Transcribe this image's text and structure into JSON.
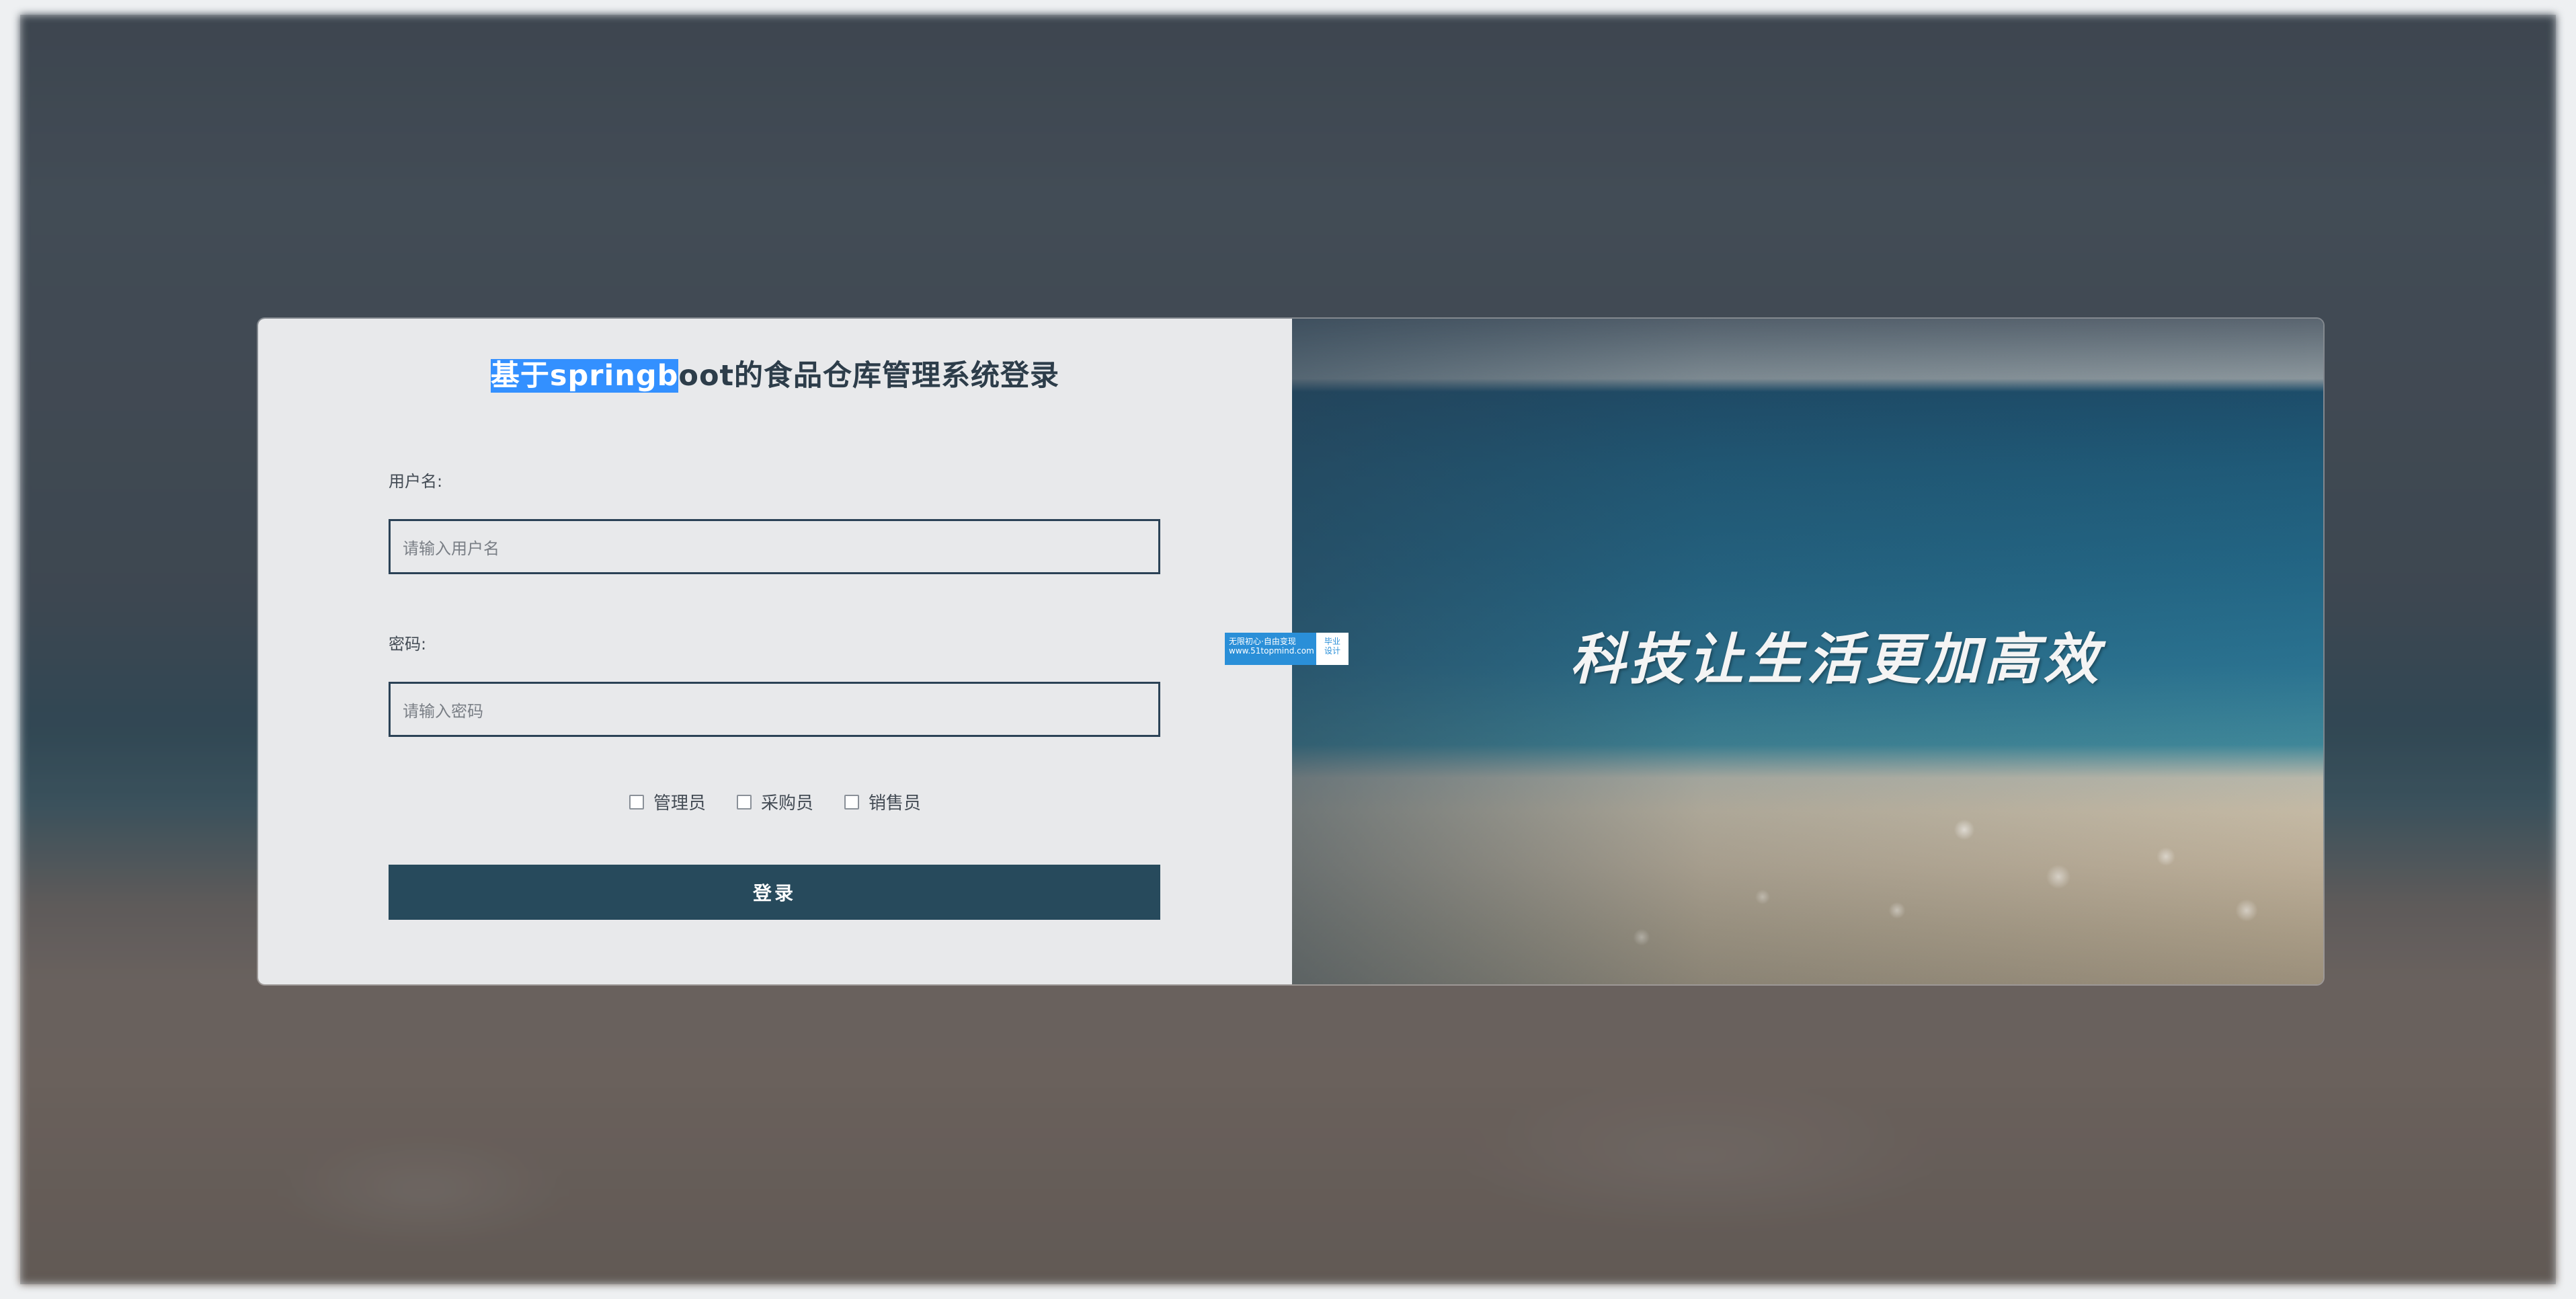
{
  "title": {
    "selected_part": "基于springb",
    "rest": "oot的食品仓库管理系统登录"
  },
  "username": {
    "label": "用户名:",
    "placeholder": "请输入用户名"
  },
  "password": {
    "label": "密码:",
    "placeholder": "请输入密码"
  },
  "roles": [
    {
      "label": "管理员",
      "checked": false
    },
    {
      "label": "采购员",
      "checked": false
    },
    {
      "label": "销售员",
      "checked": false
    }
  ],
  "login_button": "登录",
  "slogan": "科技让生活更加高效",
  "watermark": {
    "line1": "无限初心·自由变现",
    "line2": "www.51topmind.com",
    "right_line1": "毕业",
    "right_line2": "设计"
  },
  "colors": {
    "primary": "#274a5c",
    "selection": "#3390ff",
    "panel": "#e8e9eb"
  }
}
